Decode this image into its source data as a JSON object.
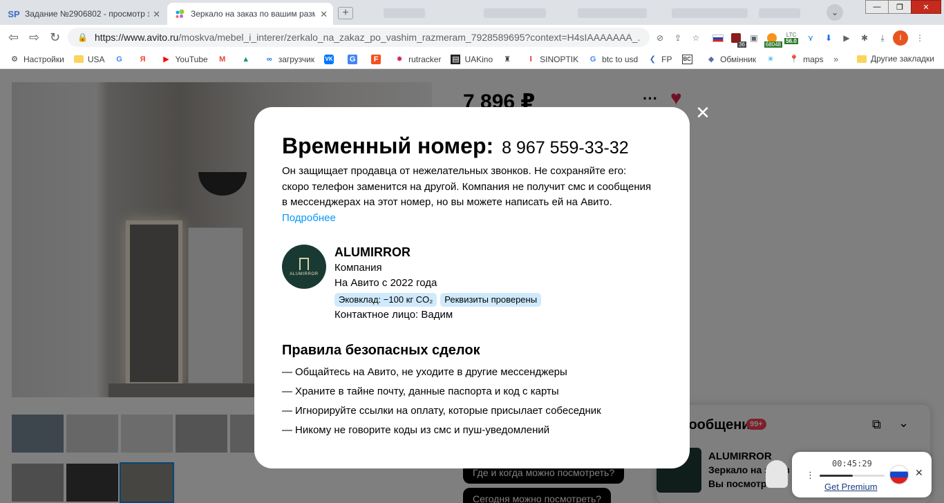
{
  "browser": {
    "tabs": [
      {
        "favicon": "SP",
        "title": "Задание №2906802 - просмотр з"
      },
      {
        "favicon": "avito-icon",
        "title": "Зеркало на заказ по вашим разм"
      }
    ],
    "url_domain": "https://www.avito.ru",
    "url_path": "/moskva/mebel_i_interer/zerkalo_na_zakaz_po_vashim_razmeram_7928589695?context=H4sIAAAAAAA_...",
    "ext_badges": {
      "b1": "36",
      "b2": "68048",
      "ltc_label": "LTC",
      "ltc_value": "56.0"
    },
    "profile_letter": "I",
    "bookmarks": [
      "Настройки",
      "USA",
      "",
      "",
      "YouTube",
      "",
      "",
      "загрузчик",
      "",
      "",
      "",
      "rutracker",
      "UAKino",
      "",
      "SINOPTIK",
      "btc to usd",
      "FP",
      "BC",
      "Обмінник",
      "",
      "maps"
    ],
    "other_bookmarks": "Другие закладки",
    "more_bookmarks": "»"
  },
  "page": {
    "price": "7 896 ₽",
    "questions": [
      "Где и когда можно посмотреть?",
      "Сегодня можно посмотреть?"
    ],
    "messages": {
      "title": "Сообщения",
      "count": "99+",
      "seller_name": "ALUMIRROR",
      "preview_line1": "Зеркало на заказ",
      "preview_line2": "Вы посмотрите"
    }
  },
  "modal": {
    "title": "Временный номер:",
    "phone": "8 967 559-33-32",
    "description": "Он защищает продавца от нежелательных звонков. Не сохраняйте его: скоро телефон заменится на другой. Компания не получит смс и сообщения в мессенджерах на этот номер, но вы можете написать ей на Авито.",
    "more_link": "Подробнее",
    "seller": {
      "logo_text": "ALUMIRROR",
      "name": "ALUMIRROR",
      "type": "Компания",
      "since": "На Авито с 2022 года",
      "tags": [
        "Эковклад: −100 кг CO₂",
        "Реквизиты проверены"
      ],
      "contact": "Контактное лицо: Вадим"
    },
    "rules_title": "Правила безопасных сделок",
    "rules": [
      "Общайтесь на Авито, не уходите в другие мессенджеры",
      "Храните в тайне почту, данные паспорта и код с карты",
      "Игнорируйте ссылки на оплату, которые присылает собеседник",
      "Никому не говорите коды из смс и пуш-уведомлений"
    ],
    "rule_dash": "—"
  },
  "extension": {
    "timer": "00:45:29",
    "progress": 0.51,
    "link": "Get Premium"
  },
  "colors": {
    "accent": "#0099f7",
    "heart": "#e3204b",
    "tag_bg": "#cfeafc",
    "logo_bg": "#193a33"
  }
}
